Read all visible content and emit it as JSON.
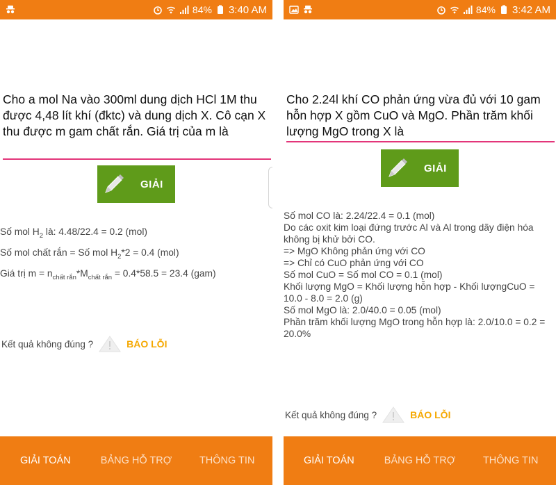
{
  "colors": {
    "statusbar": "#f07d13",
    "accent_line": "#e3357a",
    "solve_button": "#5f9b1a",
    "report_link": "#f5a800"
  },
  "left": {
    "status": {
      "battery": "84%",
      "time": "3:40 AM"
    },
    "question": "Cho a mol Na vào 300ml dung dịch HCl 1M thu được 4,48 lít khí (đktc) và dung dịch X. Cô cạn X thu được m gam chất rắn. Giá trị của m là",
    "solve_label": "GIẢI",
    "answer": {
      "l1_a": "Số mol H",
      "l1_sub": "2",
      "l1_b": " là: 4.48/22.4 = 0.2 (mol)",
      "l2_a": "Số mol chất rắn = Số mol H",
      "l2_sub": "2",
      "l2_b": "*2 = 0.4 (mol)",
      "l3_a": "Giá trị m = n",
      "l3_sub1": "chất rắn",
      "l3_b": "*M",
      "l3_sub2": "chất rắn",
      "l3_c": " = 0.4*58.5 = 23.4 (gam)"
    },
    "report_prompt": "Kết quả không đúng ?",
    "report_label": "BÁO LỖI",
    "nav": [
      "GIẢI TOÁN",
      "BẢNG HỖ TRỢ",
      "THÔNG TIN"
    ]
  },
  "right": {
    "status": {
      "battery": "84%",
      "time": "3:42 AM"
    },
    "question": "Cho 2.24l khí CO phản ứng vừa đủ với 10 gam hỗn hợp X gồm CuO và MgO. Phần trăm khối lượng MgO trong X là",
    "solve_label": "GIẢI",
    "answer_lines": [
      "Số mol CO là: 2.24/22.4 = 0.1 (mol)",
      "Do các oxit kim loại đứng trước Al và Al trong dãy điện hóa không bị khử bởi CO.",
      "=> MgO Không phản ứng với CO",
      "=> Chỉ có CuO phản ứng với CO",
      "Số mol CuO = Số mol CO = 0.1 (mol)",
      "Khối lượng MgO = Khối lượng hỗn hợp - Khối lượngCuO = 10.0 - 8.0 = 2.0 (g)",
      "Số mol MgO là: 2.0/40.0 = 0.05 (mol)",
      "Phần trăm khối lượng MgO trong hỗn hợp là: 2.0/10.0 = 0.2 = 20.0%"
    ],
    "report_prompt": "Kết quả không đúng ?",
    "report_label": "BÁO LỖI",
    "nav": [
      "GIẢI TOÁN",
      "BẢNG HỖ TRỢ",
      "THÔNG TIN"
    ]
  }
}
